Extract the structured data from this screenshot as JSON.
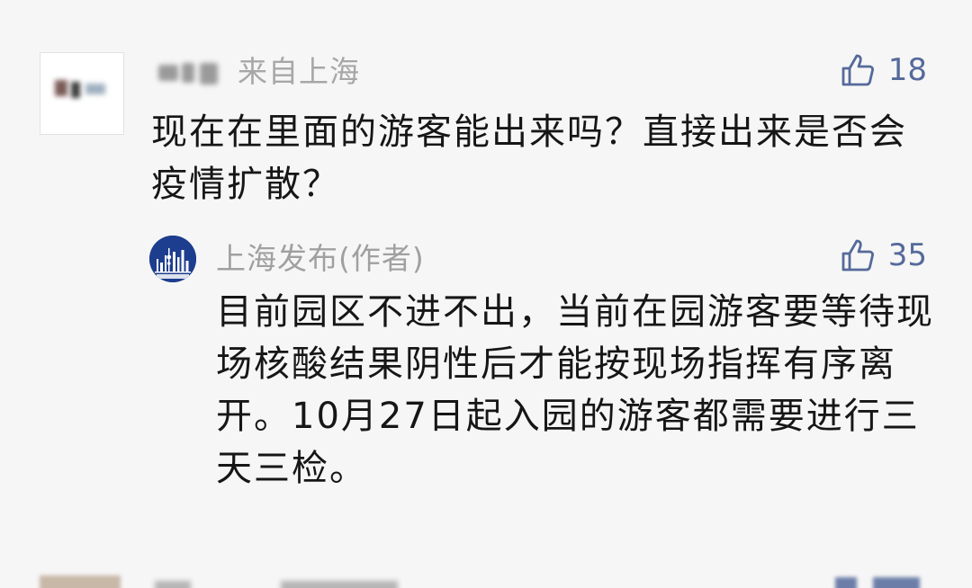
{
  "comment": {
    "location": "来自上海",
    "likes": "18",
    "text": "现在在里面的游客能出来吗？直接出来是否会疫情扩散？"
  },
  "reply": {
    "author": "上海发布(作者)",
    "likes": "35",
    "text": "目前园区不进不出，当前在园游客要等待现场核酸结果阴性后才能按现场指挥有序离开。10月27日起入园的游客都需要进行三天三检。"
  },
  "icons": {
    "like": "thumbs-up-icon",
    "avatar_author": "shanghai-skyline-logo"
  },
  "colors": {
    "background": "#f6f6f6",
    "like": "#556a9a",
    "meta_text": "#a7a7a7",
    "body_text": "#161616",
    "author_logo": "#1d3d8e"
  }
}
